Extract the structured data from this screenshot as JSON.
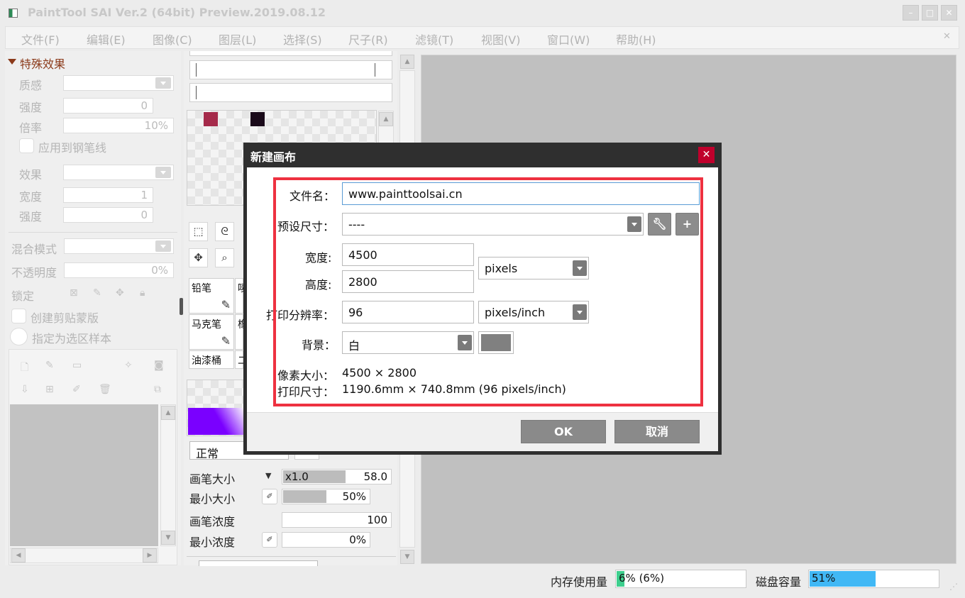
{
  "window": {
    "title": "PaintTool SAI Ver.2 (64bit) Preview.2019.08.12"
  },
  "menu": [
    "文件(F)",
    "编辑(E)",
    "图像(C)",
    "图层(L)",
    "选择(S)",
    "尺子(R)",
    "滤镜(T)",
    "视图(V)",
    "窗口(W)",
    "帮助(H)"
  ],
  "left_panel": {
    "section_title": "特殊效果",
    "texture_label": "质感",
    "strength_label": "强度",
    "strength_value": "0",
    "scale_label": "倍率",
    "scale_value": "10%",
    "apply_pen_label": "应用到钢笔线",
    "effect_label": "效果",
    "width_label": "宽度",
    "width_value": "1",
    "effect_strength_label": "强度",
    "effect_strength_value": "0",
    "blend_mode_label": "混合模式",
    "opacity_label": "不透明度",
    "opacity_value": "0%",
    "lock_label": "锁定",
    "clipping_label": "创建剪贴蒙版",
    "selection_source_label": "指定为选区样本"
  },
  "tool_panel": {
    "color_swatches": [
      "#a52a4a",
      "#1a0a1a"
    ],
    "brushes": [
      {
        "name": "铅笔"
      },
      {
        "name": "马克笔"
      },
      {
        "name": "油漆桶"
      }
    ],
    "gradient_color": "#7a00ff",
    "blend_value": "正常",
    "brush_size_label": "画笔大小",
    "brush_size_mult": "x1.0",
    "brush_size_value": "58.0",
    "min_size_label": "最小大小",
    "min_size_value": "50%",
    "min_size_fraction": 0.5,
    "brush_density_label": "画笔浓度",
    "brush_density_value": "100",
    "min_density_label": "最小浓度",
    "min_density_value": "0%"
  },
  "status": {
    "memory_label": "内存使用量",
    "memory_value": "6% (6%)",
    "memory_fraction": 0.06,
    "memory_color": "#3ecf8e",
    "disk_label": "磁盘容量",
    "disk_value": "51%",
    "disk_fraction": 0.51,
    "disk_color": "#41b8f5"
  },
  "dialog": {
    "title": "新建画布",
    "filename_label": "文件名：",
    "filename_value": "www.painttoolsai.cn",
    "preset_label": "预设尺寸：",
    "preset_value": "----",
    "width_label": "宽度:",
    "width_value": "4500",
    "height_label": "高度:",
    "height_value": "2800",
    "size_unit": "pixels",
    "resolution_label": "打印分辨率：",
    "resolution_value": "96",
    "resolution_unit": "pixels/inch",
    "background_label": "背景：",
    "background_value": "白",
    "background_color": "#808080",
    "pixel_size_label": "像素大小：",
    "pixel_size_value": "4500 × 2800",
    "print_size_label": "打印尺寸：",
    "print_size_value": "1190.6mm × 740.8mm (96 pixels/inch)",
    "ok_label": "OK",
    "cancel_label": "取消",
    "highlight_color": "#ee3140"
  }
}
